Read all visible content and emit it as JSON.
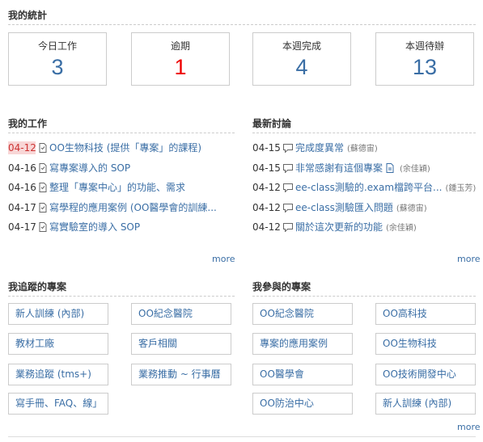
{
  "stats": {
    "title": "我的統計",
    "boxes": [
      {
        "label": "今日工作",
        "value": "3"
      },
      {
        "label": "逾期",
        "value": "1"
      },
      {
        "label": "本週完成",
        "value": "4"
      },
      {
        "label": "本週待辦",
        "value": "13"
      }
    ],
    "colors": {
      "value": "#3a6ea5",
      "overdue": "#ee0000"
    }
  },
  "my_work": {
    "title": "我的工作",
    "items": [
      {
        "date": "04-12",
        "text": "OO生物科技 (提供「專案」的課程)",
        "highlight": true
      },
      {
        "date": "04-16",
        "text": "寫專案導入的 SOP"
      },
      {
        "date": "04-16",
        "text": "整理「專案中心」的功能、需求"
      },
      {
        "date": "04-17",
        "text": "寫學程的應用案例 (OO醫學會的訓練..."
      },
      {
        "date": "04-17",
        "text": "寫實驗室的導入 SOP"
      }
    ],
    "more": "more"
  },
  "discussions": {
    "title": "最新討論",
    "items": [
      {
        "date": "04-15",
        "text": "完成度異常",
        "author": "(蘇德宙)"
      },
      {
        "date": "04-15",
        "text": "非常感謝有這個專案",
        "author": "(余佳穎)",
        "doc_icon": true
      },
      {
        "date": "04-12",
        "text": "ee-class測驗的.exam檔跨平台...",
        "author": "(鍾玉芳)"
      },
      {
        "date": "04-12",
        "text": "ee-class測驗匯入問題",
        "author": "(蘇德宙)"
      },
      {
        "date": "04-12",
        "text": "關於這次更新的功能",
        "author": "(余佳穎)"
      }
    ],
    "more": "more"
  },
  "tracked": {
    "title": "我追蹤的專案",
    "items": [
      "新人訓練 (內部)",
      "OO紀念醫院",
      "教材工廠",
      "客戶相關",
      "業務追蹤 (tms+)",
      "業務推動 ~ 行事曆",
      "寫手冊、FAQ、線」"
    ]
  },
  "joined": {
    "title": "我參與的專案",
    "items": [
      "OO紀念醫院",
      "OO高科技",
      "專案的應用案例",
      "OO生物科技",
      "OO醫學會",
      "OO技術開發中心",
      "OO防治中心",
      "新人訓練 (內部)"
    ],
    "more": "more"
  },
  "icons": {
    "task": "doc-icon",
    "discussion": "chat-icon",
    "attachment": "doc-icon"
  }
}
